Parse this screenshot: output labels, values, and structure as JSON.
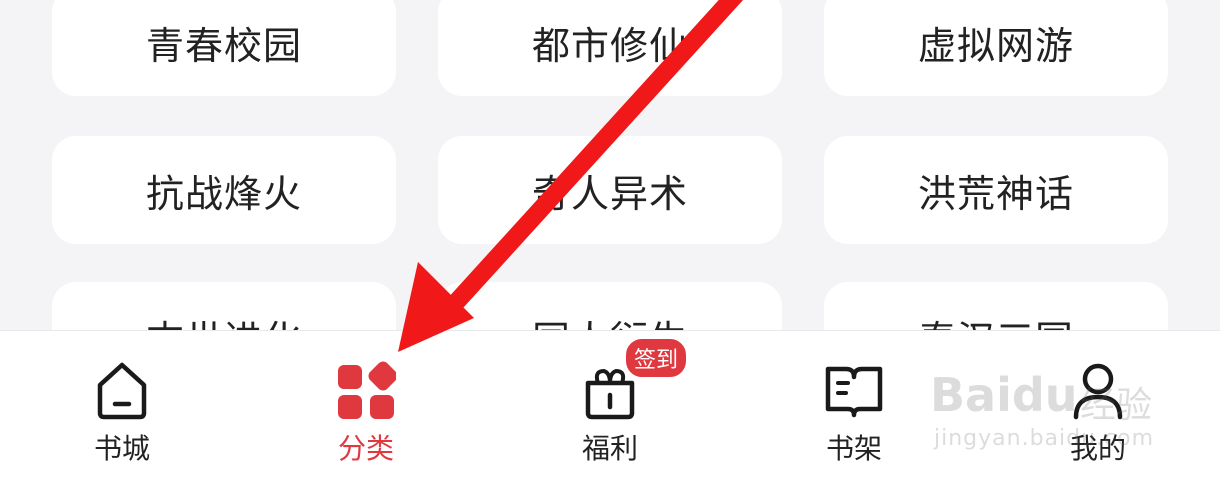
{
  "categories": [
    {
      "label": "青春校园"
    },
    {
      "label": "都市修仙"
    },
    {
      "label": "虚拟网游"
    },
    {
      "label": "抗战烽火"
    },
    {
      "label": "奇人异术"
    },
    {
      "label": "洪荒神话"
    },
    {
      "label": "末世进化"
    },
    {
      "label": "同人衍生"
    },
    {
      "label": "秦汉三国"
    }
  ],
  "tabbar": {
    "tabs": [
      {
        "label": "书城",
        "icon": "home-icon"
      },
      {
        "label": "分类",
        "icon": "category-grid-icon",
        "active": true
      },
      {
        "label": "福利",
        "icon": "gift-icon",
        "badge": "签到"
      },
      {
        "label": "书架",
        "icon": "book-icon"
      },
      {
        "label": "我的",
        "icon": "user-icon"
      }
    ]
  },
  "colors": {
    "accent": "#e0383f",
    "background": "#f4f4f6",
    "annotation_arrow": "#f01818"
  },
  "watermark": {
    "brand": "Baidu",
    "cn": "经验",
    "url": "jingyan.baidu.com"
  }
}
